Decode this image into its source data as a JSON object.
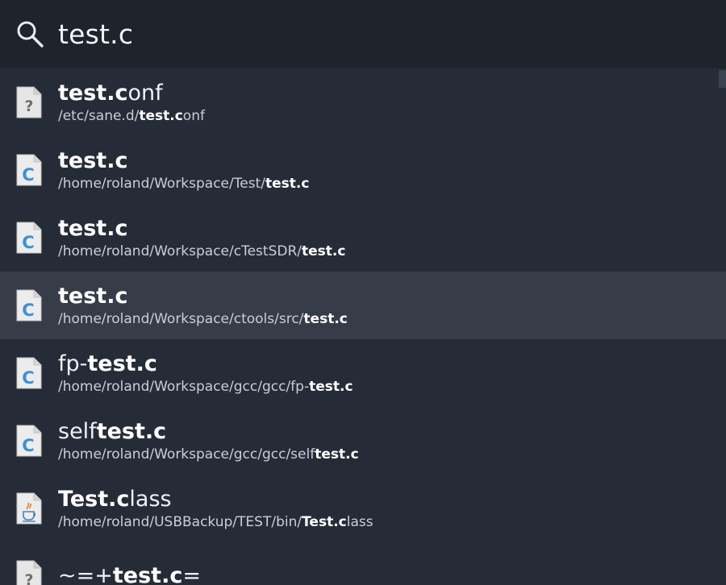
{
  "search": {
    "query": "test.c"
  },
  "results": [
    {
      "icon": "unknown-file-icon",
      "title": [
        {
          "t": "test.c",
          "b": true
        },
        {
          "t": "onf",
          "b": false
        }
      ],
      "path": [
        {
          "t": "/etc/sane.d/",
          "b": false
        },
        {
          "t": "test.c",
          "b": true
        },
        {
          "t": "onf",
          "b": false
        }
      ]
    },
    {
      "icon": "c-source-file-icon",
      "title": [
        {
          "t": "test.c",
          "b": true
        }
      ],
      "path": [
        {
          "t": "/home/roland/Workspace/Test/",
          "b": false
        },
        {
          "t": "test.c",
          "b": true
        }
      ]
    },
    {
      "icon": "c-source-file-icon",
      "title": [
        {
          "t": "test.c",
          "b": true
        }
      ],
      "path": [
        {
          "t": "/home/roland/Workspace/cTestSDR/",
          "b": false
        },
        {
          "t": "test.c",
          "b": true
        }
      ]
    },
    {
      "icon": "c-source-file-icon",
      "title": [
        {
          "t": "test.c",
          "b": true
        }
      ],
      "path": [
        {
          "t": "/home/roland/Workspace/ctools/src/",
          "b": false
        },
        {
          "t": "test.c",
          "b": true
        }
      ],
      "selected": true
    },
    {
      "icon": "c-source-file-icon",
      "title": [
        {
          "t": "fp-",
          "b": false
        },
        {
          "t": "test.c",
          "b": true
        }
      ],
      "path": [
        {
          "t": "/home/roland/Workspace/gcc/gcc/fp-",
          "b": false
        },
        {
          "t": "test.c",
          "b": true
        }
      ]
    },
    {
      "icon": "c-source-file-icon",
      "title": [
        {
          "t": "self",
          "b": false
        },
        {
          "t": "test.c",
          "b": true
        }
      ],
      "path": [
        {
          "t": "/home/roland/Workspace/gcc/gcc/self",
          "b": false
        },
        {
          "t": "test.c",
          "b": true
        }
      ]
    },
    {
      "icon": "java-class-file-icon",
      "title": [
        {
          "t": "Test.c",
          "b": true
        },
        {
          "t": "lass",
          "b": false
        }
      ],
      "path": [
        {
          "t": "/home/roland/USBBackup/TEST/bin/",
          "b": false
        },
        {
          "t": "Test.c",
          "b": true
        },
        {
          "t": "lass",
          "b": false
        }
      ]
    },
    {
      "icon": "unknown-file-icon",
      "title": [
        {
          "t": "~=+",
          "b": false
        },
        {
          "t": "test.c",
          "b": true
        },
        {
          "t": "=",
          "b": false
        }
      ],
      "path": []
    }
  ]
}
